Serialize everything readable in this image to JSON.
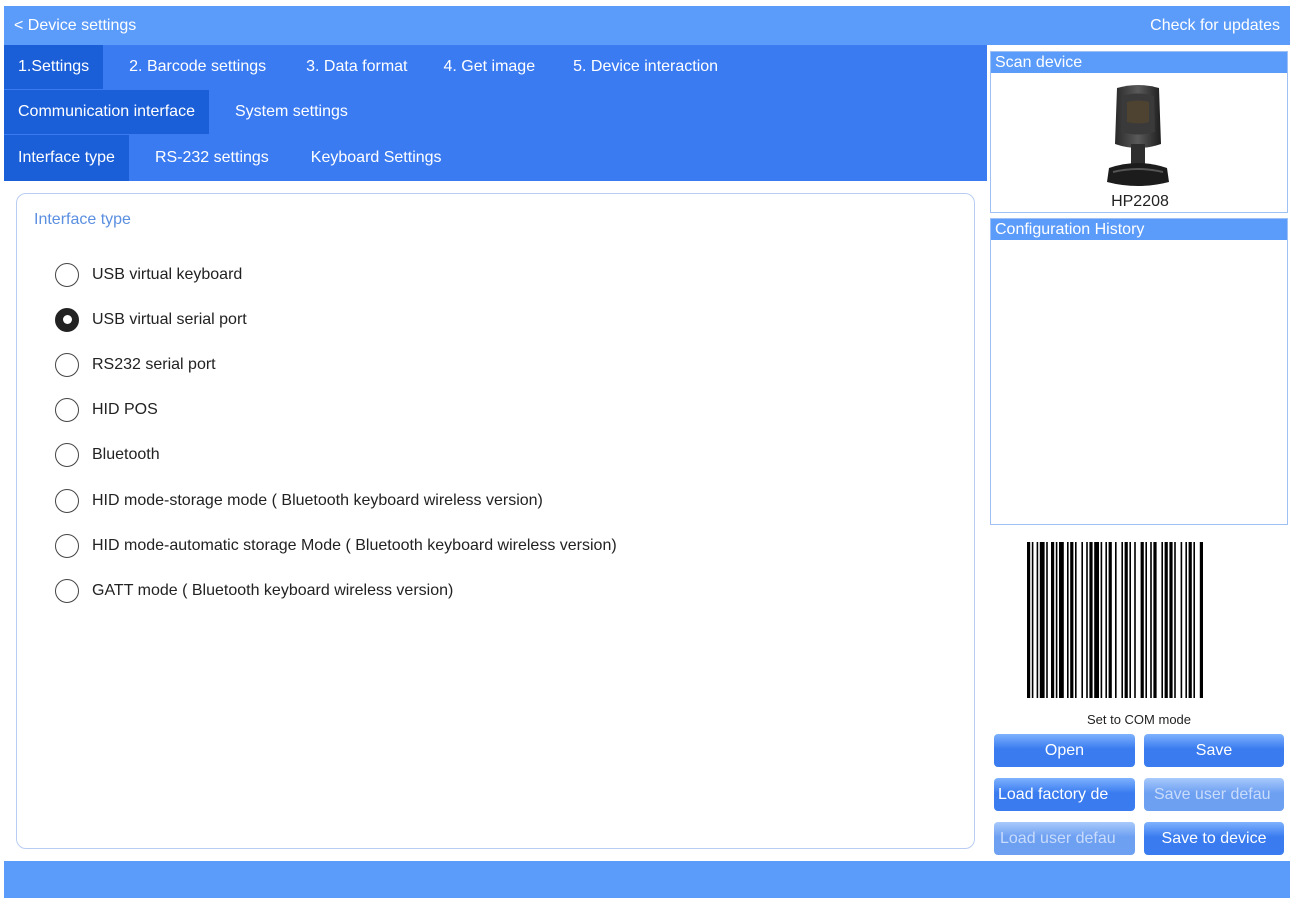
{
  "topbar": {
    "back_label": "< Device settings",
    "updates_label": "Check for updates"
  },
  "tabs_main": [
    {
      "label": "1.Settings",
      "active": true
    },
    {
      "label": "2. Barcode settings",
      "active": false
    },
    {
      "label": "3. Data format",
      "active": false
    },
    {
      "label": "4. Get image",
      "active": false
    },
    {
      "label": "5. Device interaction",
      "active": false
    }
  ],
  "tabs_sub": [
    {
      "label": "Communication interface",
      "active": true
    },
    {
      "label": "System settings",
      "active": false
    }
  ],
  "tabs_third": [
    {
      "label": "Interface type",
      "active": true
    },
    {
      "label": "RS-232 settings",
      "active": false
    },
    {
      "label": "Keyboard Settings",
      "active": false
    }
  ],
  "content": {
    "section_title": "Interface type",
    "options": [
      {
        "label": "USB virtual keyboard",
        "checked": false
      },
      {
        "label": "USB virtual serial port",
        "checked": true
      },
      {
        "label": "RS232 serial port",
        "checked": false
      },
      {
        "label": "HID POS",
        "checked": false
      },
      {
        "label": "Bluetooth",
        "checked": false
      },
      {
        "label": "HID mode-storage mode ( Bluetooth keyboard wireless version)",
        "checked": false
      },
      {
        "label": "HID mode-automatic storage Mode ( Bluetooth keyboard wireless version)",
        "checked": false
      },
      {
        "label": "GATT mode ( Bluetooth keyboard wireless version)",
        "checked": false
      }
    ]
  },
  "side": {
    "scan_device_title": "Scan device",
    "device_name": "HP2208",
    "history_title": "Configuration History",
    "barcode_caption": "Set to COM mode"
  },
  "buttons": {
    "open": "Open",
    "save": "Save",
    "load_factory": "Load factory de",
    "save_user": "Save user defau",
    "load_user": "Load user defau",
    "save_device": "Save to device"
  },
  "colors": {
    "topbar": "#5b9bf9",
    "nav_panel": "#3b7bf2",
    "active_tab": "#1a5fd8",
    "accent_text": "#5b8fe0"
  },
  "icons": {
    "device": "barcode-scanner-icon",
    "radio_checked": "radio-checked-icon",
    "radio_unchecked": "radio-unchecked-icon"
  }
}
